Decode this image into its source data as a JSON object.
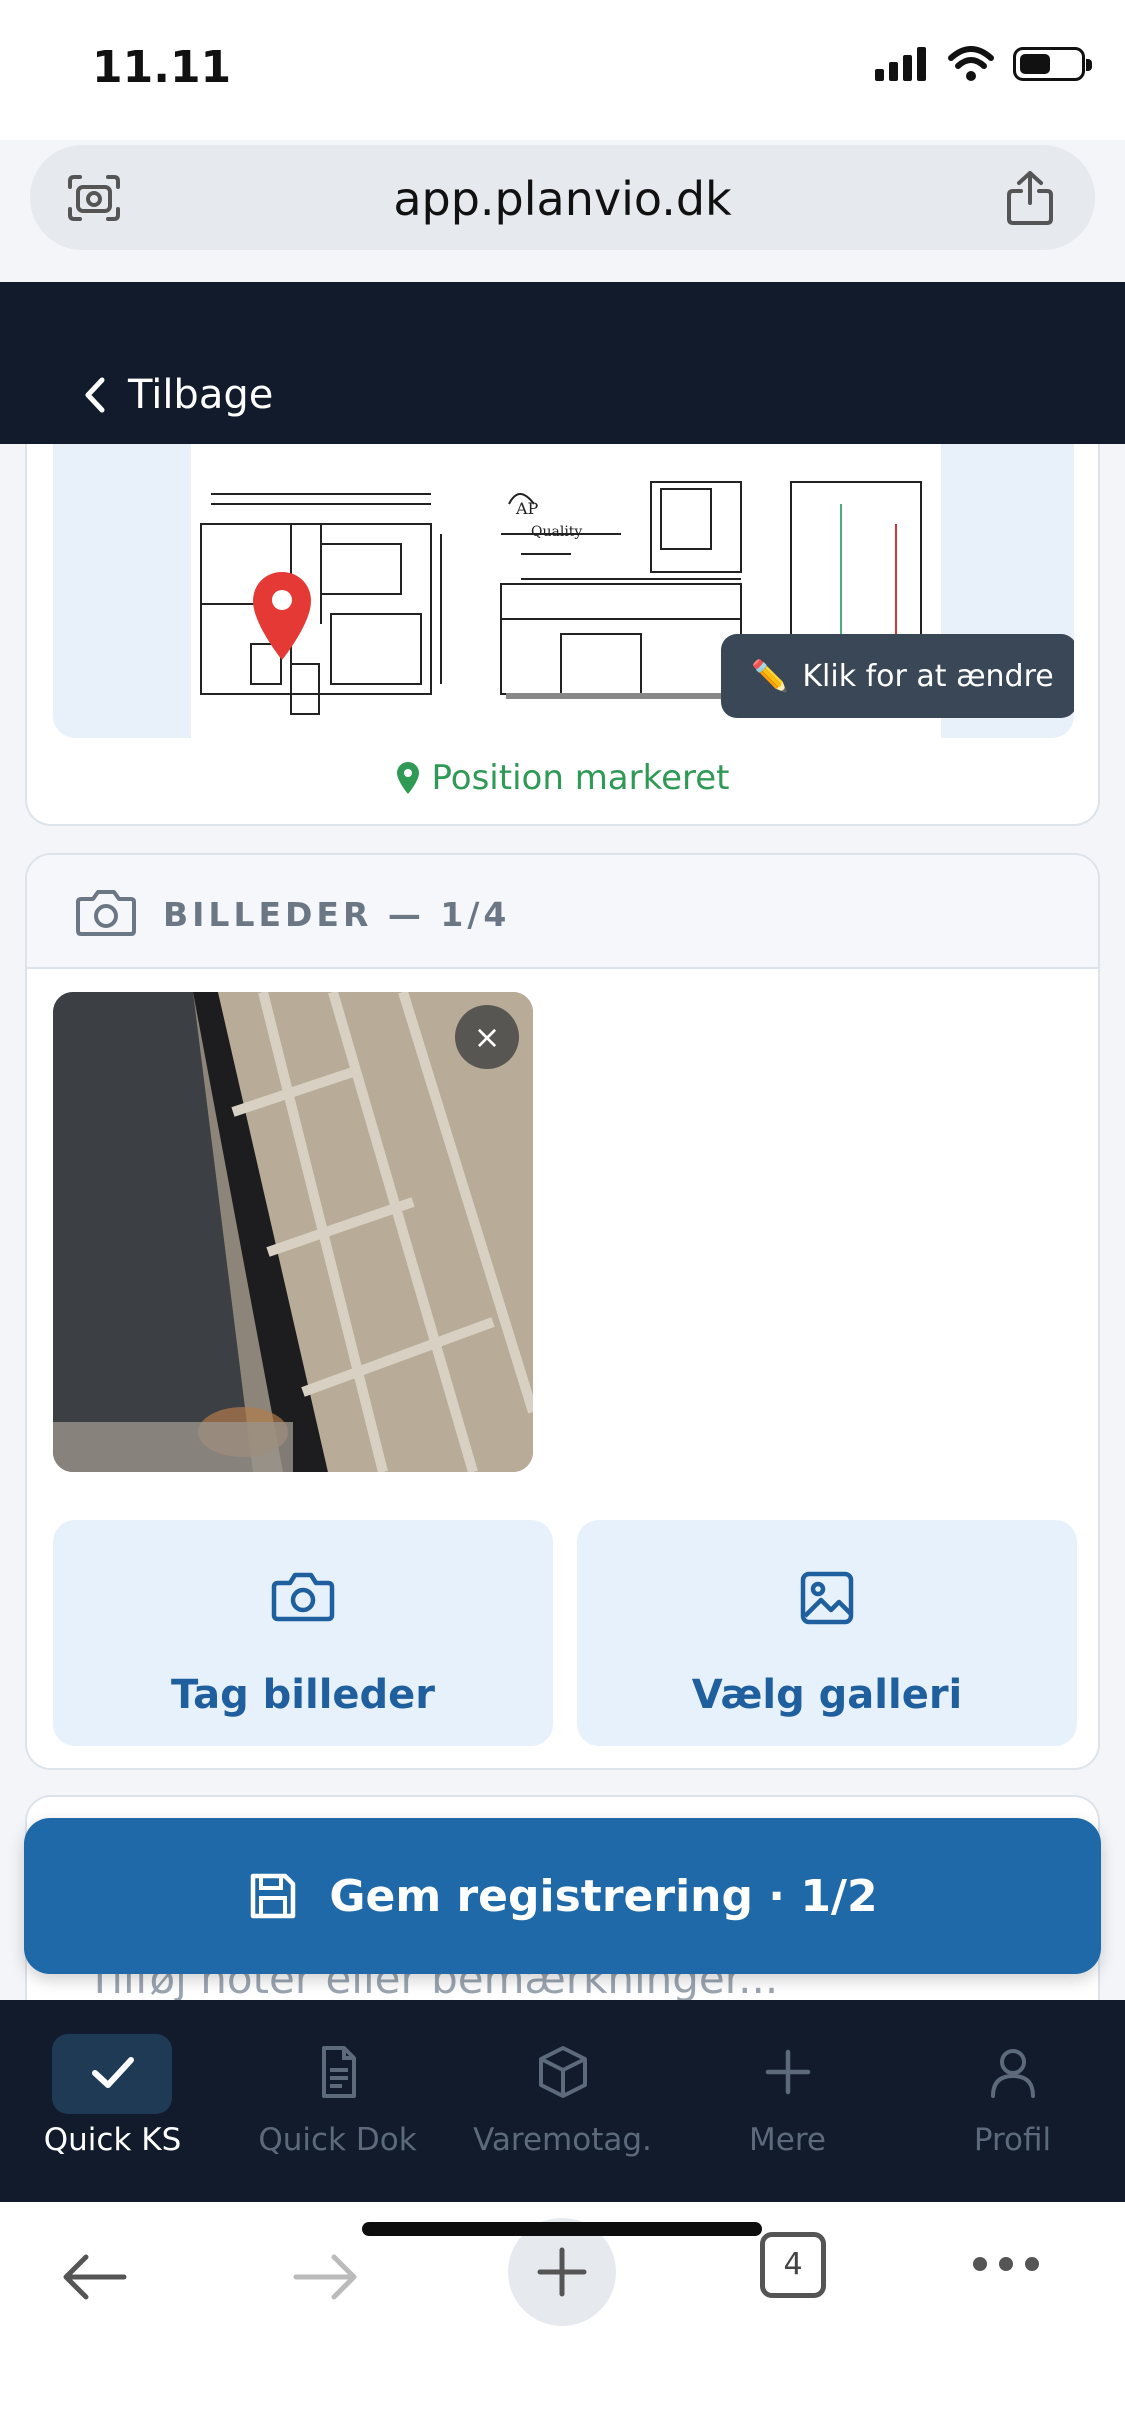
{
  "status_bar": {
    "time": "11.11"
  },
  "browser": {
    "url": "app.planvio.dk",
    "tabs_count": "4"
  },
  "header": {
    "back_label": "Tilbage"
  },
  "map": {
    "edit_hint": "Klik for at ændre",
    "position_status": "Position markeret",
    "edit_emoji": "✏️"
  },
  "photos": {
    "title": "BILLEDER — 1/4",
    "remove_label": "×",
    "take_photo_label": "Tag billeder",
    "gallery_label": "Vælg galleri"
  },
  "notes": {
    "placeholder": "Tilføj noter eller bemærkninger..."
  },
  "save": {
    "label": "Gem registrering · 1/2"
  },
  "bottom_nav": {
    "items": [
      {
        "label": "Quick KS",
        "icon": "check-icon",
        "active": true
      },
      {
        "label": "Quick Dok",
        "icon": "document-icon",
        "active": false
      },
      {
        "label": "Varemotag.",
        "icon": "box-icon",
        "active": false
      },
      {
        "label": "Mere",
        "icon": "plus-icon",
        "active": false
      },
      {
        "label": "Profil",
        "icon": "user-icon",
        "active": false
      }
    ]
  },
  "colors": {
    "header_bg": "#111b2b",
    "primary_button": "#1f69a8",
    "action_button_bg": "#e6f1fb",
    "success_green": "#2f9a55",
    "pin_red": "#e53935"
  }
}
